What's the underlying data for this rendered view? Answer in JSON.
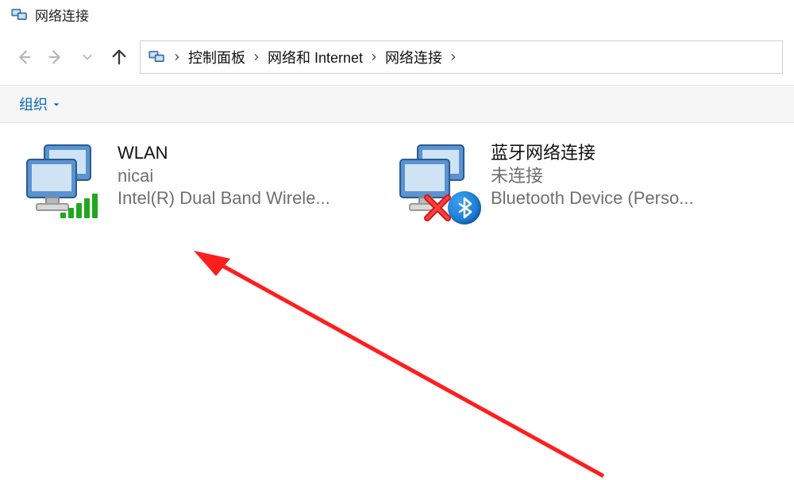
{
  "window": {
    "title": "网络连接"
  },
  "breadcrumb": {
    "items": [
      {
        "label": "控制面板"
      },
      {
        "label": "网络和 Internet"
      },
      {
        "label": "网络连接"
      }
    ]
  },
  "commandbar": {
    "organize_label": "组织"
  },
  "connections": [
    {
      "title": "WLAN",
      "line2": "nicai",
      "line3": "Intel(R) Dual Band Wirele...",
      "status_icon": "wifi-signal-icon"
    },
    {
      "title": "蓝牙网络连接",
      "line2": "未连接",
      "line3": "Bluetooth Device (Perso...",
      "status_icon": "disconnected-x-icon",
      "badge_icon": "bluetooth-icon"
    }
  ],
  "annotation": {
    "color": "#ff1e1e"
  }
}
